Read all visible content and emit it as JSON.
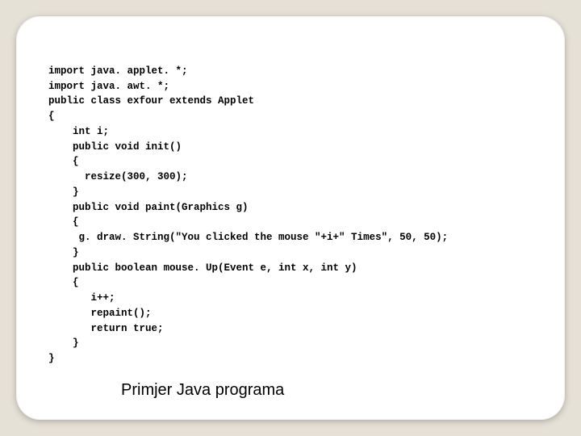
{
  "code": {
    "l1": "import java. applet. *;",
    "l2": "import java. awt. *;",
    "l3": "public class exfour extends Applet",
    "l4": "{",
    "l5": "    int i;",
    "l6": "    public void init()",
    "l7": "    {",
    "l8": "      resize(300, 300);",
    "l9": "    }",
    "l10": "    public void paint(Graphics g)",
    "l11": "    {",
    "l12": "     g. draw. String(\"You clicked the mouse \"+i+\" Times\", 50, 50);",
    "l13": "    }",
    "l14": "    public boolean mouse. Up(Event e, int x, int y)",
    "l15": "    {",
    "l16": "       i++;",
    "l17": "       repaint();",
    "l18": "       return true;",
    "l19": "    }",
    "l20": "}"
  },
  "caption": "Primjer Java programa"
}
